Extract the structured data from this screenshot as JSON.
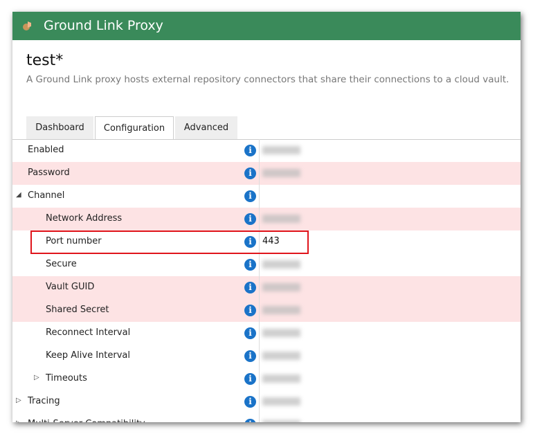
{
  "header": {
    "app_title": "Ground Link Proxy",
    "icon": "plugin-icon"
  },
  "page": {
    "title": "test*",
    "description": "A Ground Link proxy hosts external repository connectors that share their connections to a cloud vault."
  },
  "tabs": [
    {
      "label": "Dashboard"
    },
    {
      "label": "Configuration",
      "active": true
    },
    {
      "label": "Advanced"
    }
  ],
  "colors": {
    "header": "#3a8a5a",
    "error_row": "#fde3e4",
    "info": "#1a73c8",
    "highlight": "#e0141b"
  },
  "rows": [
    {
      "label": "Enabled",
      "error": false
    },
    {
      "label": "Password",
      "error": true
    },
    {
      "label": "Channel",
      "expander": "expanded"
    },
    {
      "label": "Network Address",
      "error": true
    },
    {
      "label": "Port number",
      "value": "443",
      "highlighted": true
    },
    {
      "label": "Secure"
    },
    {
      "label": "Vault GUID",
      "error": true
    },
    {
      "label": "Shared Secret",
      "error": true
    },
    {
      "label": "Reconnect Interval"
    },
    {
      "label": "Keep Alive Interval"
    },
    {
      "label": "Timeouts",
      "expander": "collapsed"
    },
    {
      "label": "Tracing",
      "expander": "collapsed"
    },
    {
      "label": "Multi-Server Compatibility",
      "expander": "collapsed"
    }
  ]
}
